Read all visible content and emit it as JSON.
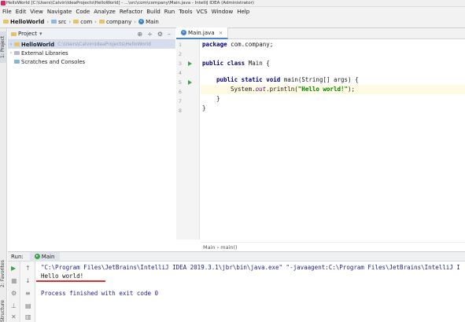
{
  "titlebar": {
    "text": "HelloWorld [C:\\Users\\Calvin\\IdeaProjects\\HelloWorld] - ...\\src\\com\\company\\Main.java - IntelliJ IDEA (Administrator)"
  },
  "menu": [
    "File",
    "Edit",
    "View",
    "Navigate",
    "Code",
    "Analyze",
    "Refactor",
    "Build",
    "Run",
    "Tools",
    "VCS",
    "Window",
    "Help"
  ],
  "navbar": {
    "project": "HelloWorld",
    "src": "src",
    "com": "com",
    "company": "company",
    "main": "Main"
  },
  "leftstrip": {
    "project_tab": "1: Project",
    "favorites_tab": "2: Favorites",
    "structure_tab": "Structure"
  },
  "project": {
    "header": "Project",
    "tree": [
      {
        "label": "HelloWorld",
        "path": "C:\\Users\\Calvin\\IdeaProjects\\HelloWorld"
      },
      {
        "label": "External Libraries"
      },
      {
        "label": "Scratches and Consoles"
      }
    ]
  },
  "editor": {
    "tab": "Main.java",
    "lines": [
      "1",
      "2",
      "3",
      "4",
      "5",
      "6",
      "7",
      "8"
    ],
    "breadcrumb": "Main  ›  main()"
  },
  "code": {
    "pkg_kw": "package",
    "pkg_name": " com.company;",
    "cls_kw": "public class",
    "cls_name": " Main {",
    "m_kw": "public static void",
    "m_rest": " main(String[] args) {",
    "sys": "System.",
    "out": "out",
    "println": ".println(",
    "str": "\"Hello world!\"",
    "end": ");",
    "close1": "}",
    "close2": "}"
  },
  "run": {
    "label": "Run:",
    "tab": "Main",
    "console": [
      "\"C:\\Program Files\\JetBrains\\IntelliJ IDEA 2019.3.1\\jbr\\bin\\java.exe\" \"-javaagent:C:\\Program Files\\JetBrains\\IntelliJ I",
      "Hello world!",
      "",
      "Process finished with exit code 0"
    ]
  },
  "colors": {
    "keyword": "#000080",
    "string": "#008000",
    "accent": "#4a88c7",
    "underline": "#d93030"
  }
}
